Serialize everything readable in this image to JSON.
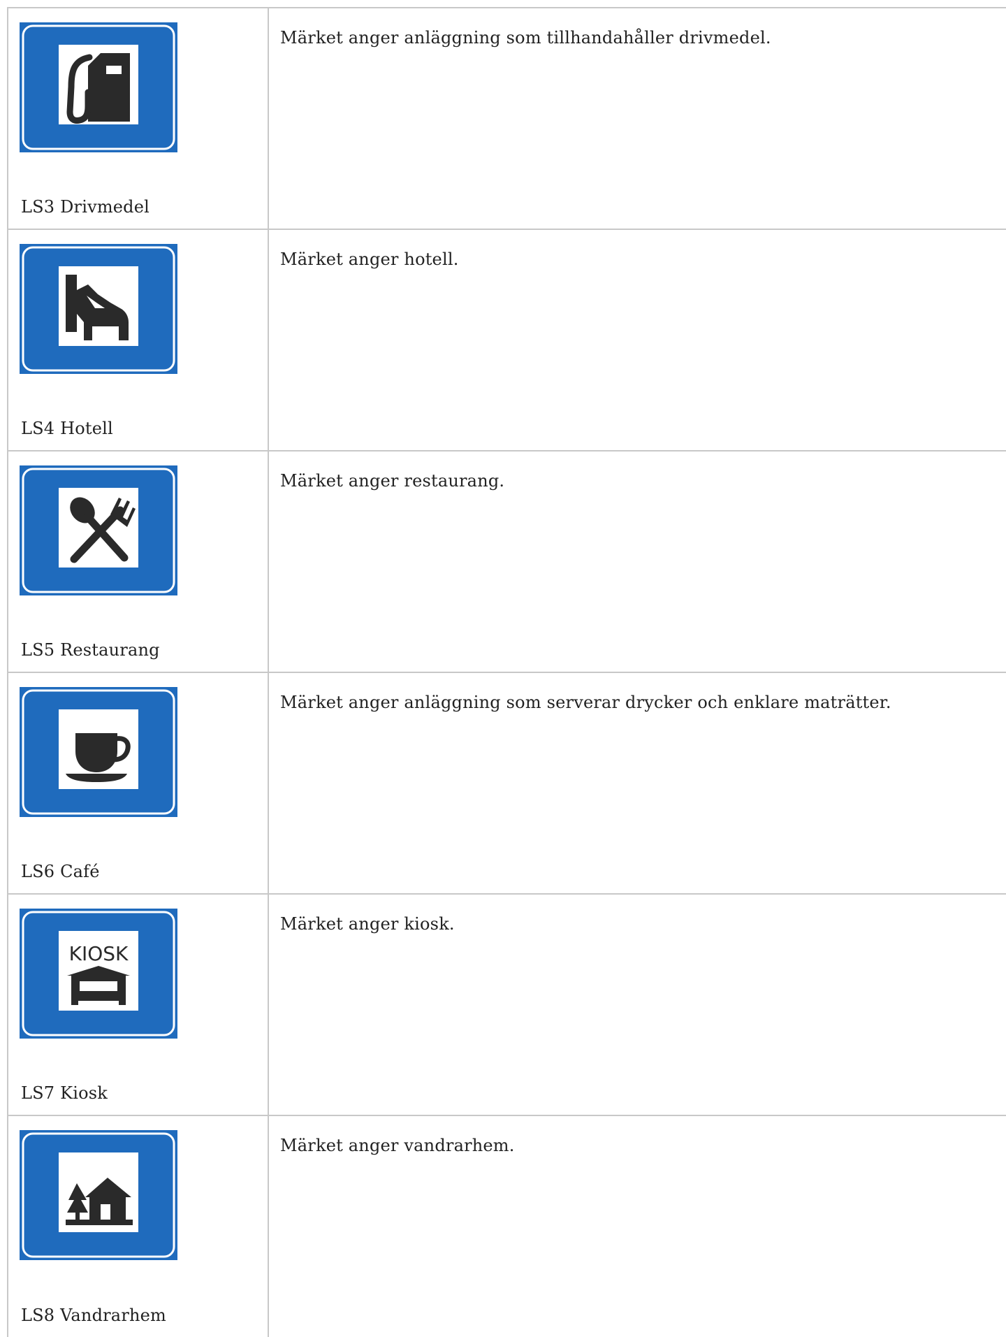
{
  "colors": {
    "sign_blue": "#1f6bbd",
    "sign_border": "#ffffff",
    "symbol": "#2a2a2a",
    "cell_border": "#c8c8c8"
  },
  "signs": [
    {
      "caption": "LS3 Drivmedel",
      "description": "Märket anger anläggning som tillhandahåller drivmedel.",
      "icon": "fuel-pump-icon"
    },
    {
      "caption": "LS4 Hotell",
      "description": "Märket anger hotell.",
      "icon": "bed-icon"
    },
    {
      "caption": "LS5 Restaurang",
      "description": "Märket anger restaurang.",
      "icon": "fork-and-spoon-icon"
    },
    {
      "caption": "LS6 Café",
      "description": "Märket anger anläggning som serverar drycker och enklare maträtter.",
      "icon": "coffee-cup-icon"
    },
    {
      "caption": "LS7 Kiosk",
      "description": "Märket anger kiosk.",
      "icon": "kiosk-icon",
      "icon_text": "KIOSK"
    },
    {
      "caption": "LS8 Vandrarhem",
      "description": "Märket anger vandrarhem.",
      "icon": "hostel-icon"
    }
  ]
}
